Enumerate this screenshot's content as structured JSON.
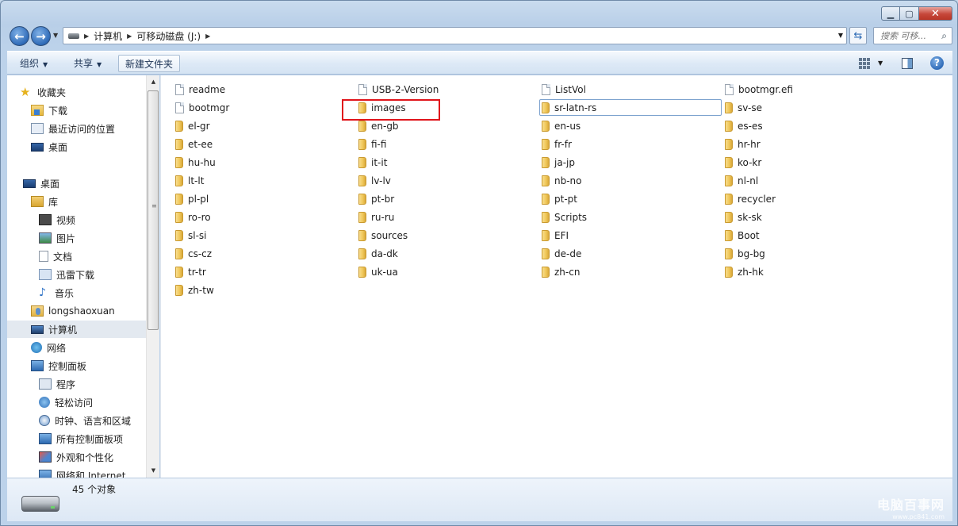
{
  "window": {
    "minimize_glyph": "▁",
    "maximize_glyph": "▢",
    "close_glyph": "✕"
  },
  "address": {
    "crumbs": [
      "计算机",
      "可移动磁盘 (J:)"
    ],
    "search_placeholder": "搜索 可移...",
    "refresh_glyph": "⇆"
  },
  "toolbar": {
    "organize_label": "组织",
    "share_label": "共享",
    "new_folder_label": "新建文件夹"
  },
  "nav": {
    "items": [
      {
        "label": "收藏夹",
        "icon": "star-icon"
      },
      {
        "label": "下载",
        "icon": "download-folder-icon"
      },
      {
        "label": "最近访问的位置",
        "icon": "recent-places-icon"
      },
      {
        "label": "桌面",
        "icon": "desktop-icon"
      },
      {
        "label": "桌面",
        "icon": "desktop-icon"
      },
      {
        "label": "库",
        "icon": "library-icon"
      },
      {
        "label": "视频",
        "icon": "video-library-icon"
      },
      {
        "label": "图片",
        "icon": "pictures-library-icon"
      },
      {
        "label": "文档",
        "icon": "documents-library-icon"
      },
      {
        "label": "迅雷下载",
        "icon": "xunlei-download-icon"
      },
      {
        "label": "音乐",
        "icon": "music-library-icon"
      },
      {
        "label": "longshaoxuan",
        "icon": "user-folder-icon"
      },
      {
        "label": "计算机",
        "icon": "computer-icon"
      },
      {
        "label": "网络",
        "icon": "network-icon"
      },
      {
        "label": "控制面板",
        "icon": "control-panel-icon"
      },
      {
        "label": "程序",
        "icon": "programs-icon"
      },
      {
        "label": "轻松访问",
        "icon": "ease-of-access-icon"
      },
      {
        "label": "时钟、语言和区域",
        "icon": "clock-language-region-icon"
      },
      {
        "label": "所有控制面板项",
        "icon": "all-control-panel-items-icon"
      },
      {
        "label": "外观和个性化",
        "icon": "appearance-icon"
      },
      {
        "label": "网络和 Internet",
        "icon": "network-internet-icon"
      }
    ]
  },
  "files": [
    {
      "name": "readme",
      "type": "file"
    },
    {
      "name": "USB-2-Version",
      "type": "file"
    },
    {
      "name": "ListVol",
      "type": "file"
    },
    {
      "name": "bootmgr.efi",
      "type": "file"
    },
    {
      "name": "bootmgr",
      "type": "file"
    },
    {
      "name": "images",
      "type": "folder"
    },
    {
      "name": "sr-latn-rs",
      "type": "folder"
    },
    {
      "name": "sv-se",
      "type": "folder"
    },
    {
      "name": "el-gr",
      "type": "folder"
    },
    {
      "name": "en-gb",
      "type": "folder"
    },
    {
      "name": "en-us",
      "type": "folder"
    },
    {
      "name": "es-es",
      "type": "folder"
    },
    {
      "name": "et-ee",
      "type": "folder"
    },
    {
      "name": "fi-fi",
      "type": "folder"
    },
    {
      "name": "fr-fr",
      "type": "folder"
    },
    {
      "name": "hr-hr",
      "type": "folder"
    },
    {
      "name": "hu-hu",
      "type": "folder"
    },
    {
      "name": "it-it",
      "type": "folder"
    },
    {
      "name": "ja-jp",
      "type": "folder"
    },
    {
      "name": "ko-kr",
      "type": "folder"
    },
    {
      "name": "lt-lt",
      "type": "folder"
    },
    {
      "name": "lv-lv",
      "type": "folder"
    },
    {
      "name": "nb-no",
      "type": "folder"
    },
    {
      "name": "nl-nl",
      "type": "folder"
    },
    {
      "name": "pl-pl",
      "type": "folder"
    },
    {
      "name": "pt-br",
      "type": "folder"
    },
    {
      "name": "pt-pt",
      "type": "folder"
    },
    {
      "name": "recycler",
      "type": "folder"
    },
    {
      "name": "ro-ro",
      "type": "folder"
    },
    {
      "name": "ru-ru",
      "type": "folder"
    },
    {
      "name": "Scripts",
      "type": "folder"
    },
    {
      "name": "sk-sk",
      "type": "folder"
    },
    {
      "name": "sl-si",
      "type": "folder"
    },
    {
      "name": "sources",
      "type": "folder"
    },
    {
      "name": "EFI",
      "type": "folder"
    },
    {
      "name": "Boot",
      "type": "folder"
    },
    {
      "name": "cs-cz",
      "type": "folder"
    },
    {
      "name": "da-dk",
      "type": "folder"
    },
    {
      "name": "de-de",
      "type": "folder"
    },
    {
      "name": "bg-bg",
      "type": "folder"
    },
    {
      "name": "tr-tr",
      "type": "folder"
    },
    {
      "name": "uk-ua",
      "type": "folder"
    },
    {
      "name": "zh-cn",
      "type": "folder"
    },
    {
      "name": "zh-hk",
      "type": "folder"
    },
    {
      "name": "zh-tw",
      "type": "folder"
    }
  ],
  "status": {
    "item_count": "45 个对象"
  },
  "watermark": {
    "text": "电脑百事网",
    "subtext": "www.pc841.com"
  },
  "colors": {
    "highlight_box": "#e0151b",
    "focus_border": "#7da2ce"
  }
}
